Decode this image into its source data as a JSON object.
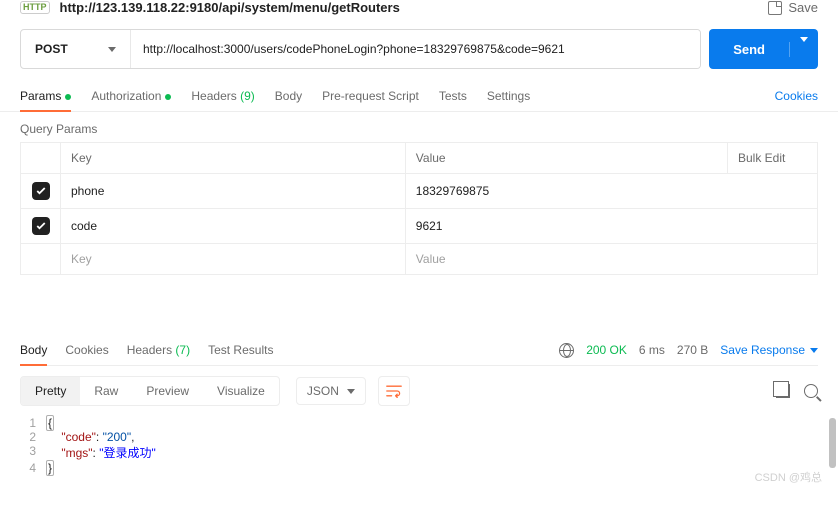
{
  "top": {
    "url_title": "http://123.139.118.22:9180/api/system/menu/getRouters",
    "save_label": "Save"
  },
  "request": {
    "method": "POST",
    "url": "http://localhost:3000/users/codePhoneLogin?phone=18329769875&code=9621",
    "send_label": "Send"
  },
  "tabs": {
    "params": "Params",
    "auth": "Authorization",
    "headers": "Headers",
    "headers_count": "(9)",
    "body": "Body",
    "prs": "Pre-request Script",
    "tests": "Tests",
    "settings": "Settings",
    "cookies": "Cookies"
  },
  "query": {
    "title": "Query Params",
    "header_key": "Key",
    "header_value": "Value",
    "bulk": "Bulk Edit",
    "rows": [
      {
        "key": "phone",
        "value": "18329769875"
      },
      {
        "key": "code",
        "value": "9621"
      }
    ],
    "placeholder_key": "Key",
    "placeholder_value": "Value"
  },
  "response": {
    "tabs": {
      "body": "Body",
      "cookies": "Cookies",
      "headers": "Headers",
      "headers_count": "(7)",
      "test_results": "Test Results"
    },
    "status": "200 OK",
    "time": "6 ms",
    "size": "270 B",
    "save_label": "Save Response",
    "view": {
      "pretty": "Pretty",
      "raw": "Raw",
      "preview": "Preview",
      "visualize": "Visualize",
      "format": "JSON"
    },
    "json": {
      "code_key": "\"code\"",
      "code_val": "\"200\"",
      "mgs_key": "\"mgs\"",
      "mgs_val": "\"登录成功\""
    }
  },
  "watermark": "CSDN @鸡总"
}
